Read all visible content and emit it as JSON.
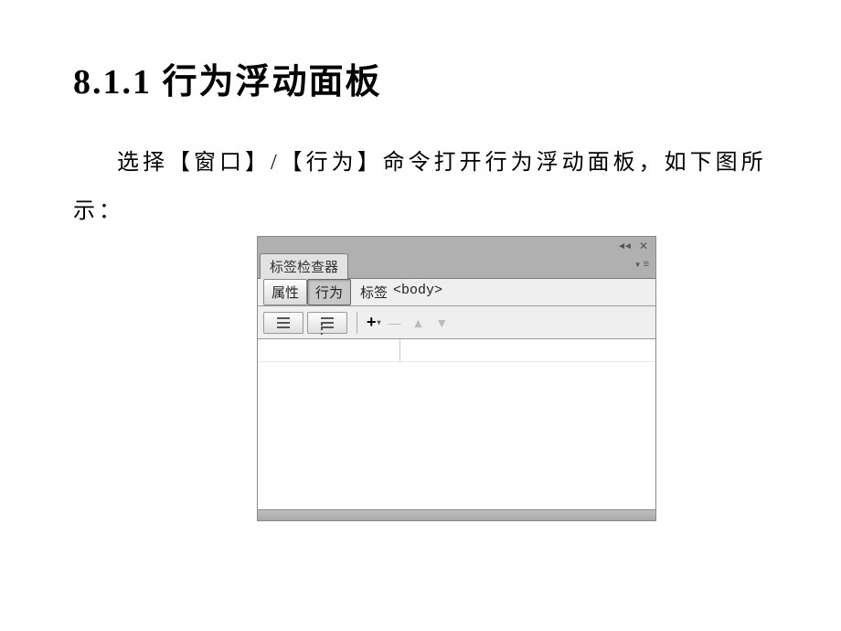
{
  "doc": {
    "heading": "8.1.1 行为浮动面板",
    "paragraph": "选择【窗口】/【行为】命令打开行为浮动面板，如下图所示："
  },
  "panel": {
    "title_tab": "标签检查器",
    "subtabs": {
      "attrs": "属性",
      "behaviors": "行为"
    },
    "tag_label": "标签",
    "tag_value": "<body>"
  }
}
